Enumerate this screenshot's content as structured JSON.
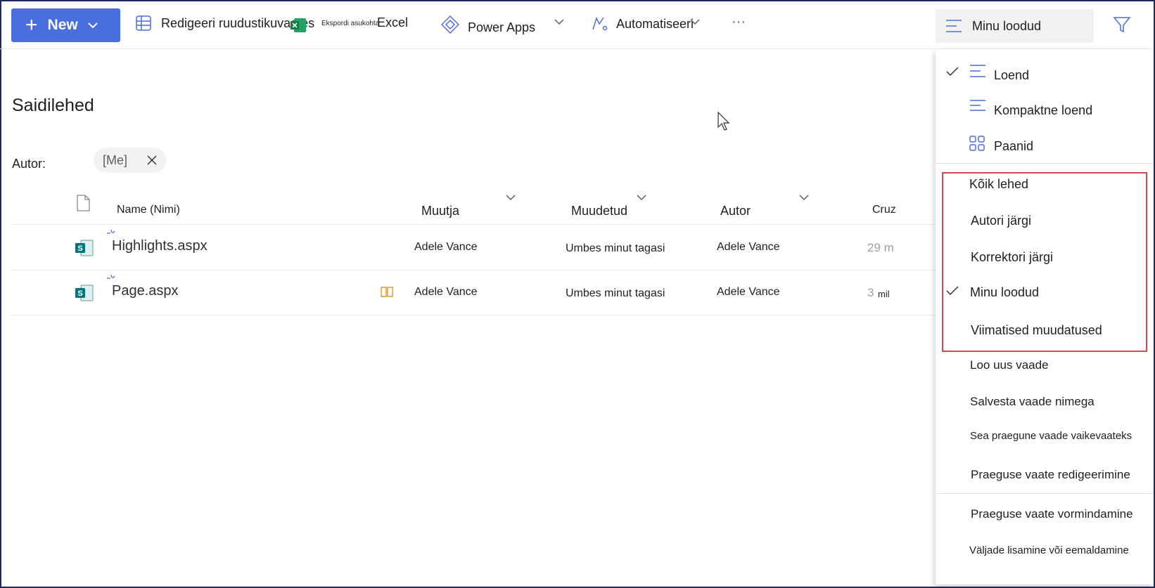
{
  "toolbar": {
    "new_label": "New",
    "edit_grid_label": "Redigeeri ruudustikuvaates",
    "export_small_label": "Ekspordi asukohta",
    "excel_label": "Excel",
    "powerapps_label": "Power Apps",
    "automate_label": "Automatiseeri",
    "more_label": "···",
    "view_selector_label": "Minu loodud"
  },
  "page": {
    "title": "Saidilehed",
    "filter_label": "Autor:",
    "filter_chip": "[Me]"
  },
  "columns": [
    "Name (Nimi)",
    "Muutja",
    "Muudetud",
    "Autor",
    "Cruz"
  ],
  "rows": [
    {
      "name": "Highlights.aspx",
      "modifier": "Adele Vance",
      "modified": "Umbes minut tagasi",
      "author": "Adele Vance",
      "extra": "29 m"
    },
    {
      "name": "Page.aspx",
      "modifier": "Adele Vance",
      "modified": "Umbes minut tagasi",
      "author": "Adele Vance",
      "extra": "3",
      "extra2": "mil"
    }
  ],
  "menu": {
    "layouts": [
      "Loend",
      "Kompaktne loend",
      "Paanid"
    ],
    "views": [
      "Kõik lehed",
      "Autori järgi",
      "Korrektori järgi",
      "Minu loodud",
      "Viimatised muudatused"
    ],
    "actions": [
      "Loo uus vaade",
      "Salvesta vaade nimega",
      "Sea praegune vaade vaikevaateks",
      "Praeguse vaate redigeerimine"
    ],
    "format": [
      "Praeguse vaate vormindamine",
      "Väljade lisamine või eemaldamine"
    ]
  },
  "colors": {
    "accent": "#4a6fdc",
    "highlight_border": "#d9474f",
    "sharepoint_green": "#03787c"
  }
}
